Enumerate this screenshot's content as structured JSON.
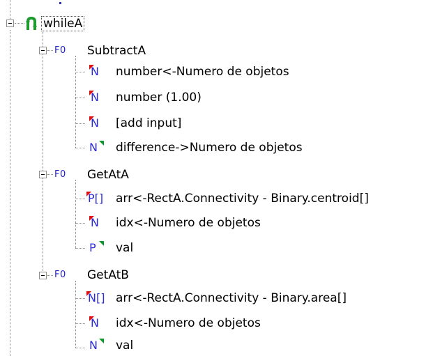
{
  "tree": {
    "root": {
      "label": "whileA",
      "icon": "loop-icon"
    },
    "functions": [
      {
        "tag": "F0",
        "label": "SubtractA",
        "children": [
          {
            "type": "N",
            "label": "number<-Numero de objetos",
            "direction": "input"
          },
          {
            "type": "N",
            "label": "number (1.00)",
            "direction": "input"
          },
          {
            "type": "N",
            "label": "[add input]",
            "direction": "input"
          },
          {
            "type": "N",
            "label": "difference->Numero de objetos",
            "direction": "output"
          }
        ]
      },
      {
        "tag": "F0",
        "label": "GetAtA",
        "children": [
          {
            "type": "P[]",
            "label": "arr<-RectA.Connectivity - Binary.centroid[]",
            "direction": "input"
          },
          {
            "type": "N",
            "label": "idx<-Numero de objetos",
            "direction": "input"
          },
          {
            "type": "P",
            "label": "val",
            "direction": "output"
          }
        ]
      },
      {
        "tag": "F0",
        "label": "GetAtB",
        "children": [
          {
            "type": "N[]",
            "label": "arr<-RectA.Connectivity - Binary.area[]",
            "direction": "input"
          },
          {
            "type": "N",
            "label": "idx<-Numero de objetos",
            "direction": "input"
          },
          {
            "type": "N",
            "label": "val",
            "direction": "output"
          }
        ]
      }
    ]
  },
  "colors": {
    "port_text": "#2b2bd8",
    "input_marker": "#e01010",
    "output_marker": "#0a9a2a",
    "loop_icon": "#1f9a2f"
  }
}
